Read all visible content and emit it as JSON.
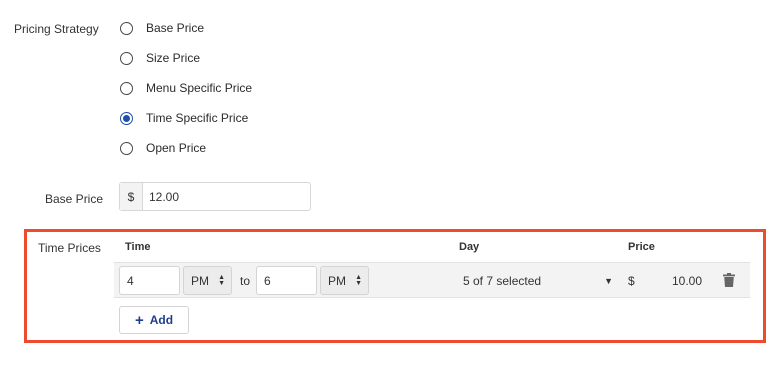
{
  "pricing_strategy": {
    "label": "Pricing Strategy",
    "options": [
      {
        "label": "Base Price",
        "selected": false
      },
      {
        "label": "Size Price",
        "selected": false
      },
      {
        "label": "Menu Specific Price",
        "selected": false
      },
      {
        "label": "Time Specific Price",
        "selected": true
      },
      {
        "label": "Open Price",
        "selected": false
      }
    ]
  },
  "base_price": {
    "label": "Base Price",
    "currency": "$",
    "value": "12.00"
  },
  "time_prices": {
    "label": "Time Prices",
    "headers": {
      "time": "Time",
      "day": "Day",
      "price": "Price"
    },
    "rows": [
      {
        "start_hour": "4",
        "start_period": "PM",
        "to_text": "to",
        "end_hour": "6",
        "end_period": "PM",
        "day_summary": "5 of 7 selected",
        "currency": "$",
        "price": "10.00"
      }
    ],
    "add_button": {
      "plus": "+",
      "label": "Add"
    }
  },
  "colors": {
    "accent": "#1f4fa8",
    "highlight_border": "#ee4a2d"
  }
}
